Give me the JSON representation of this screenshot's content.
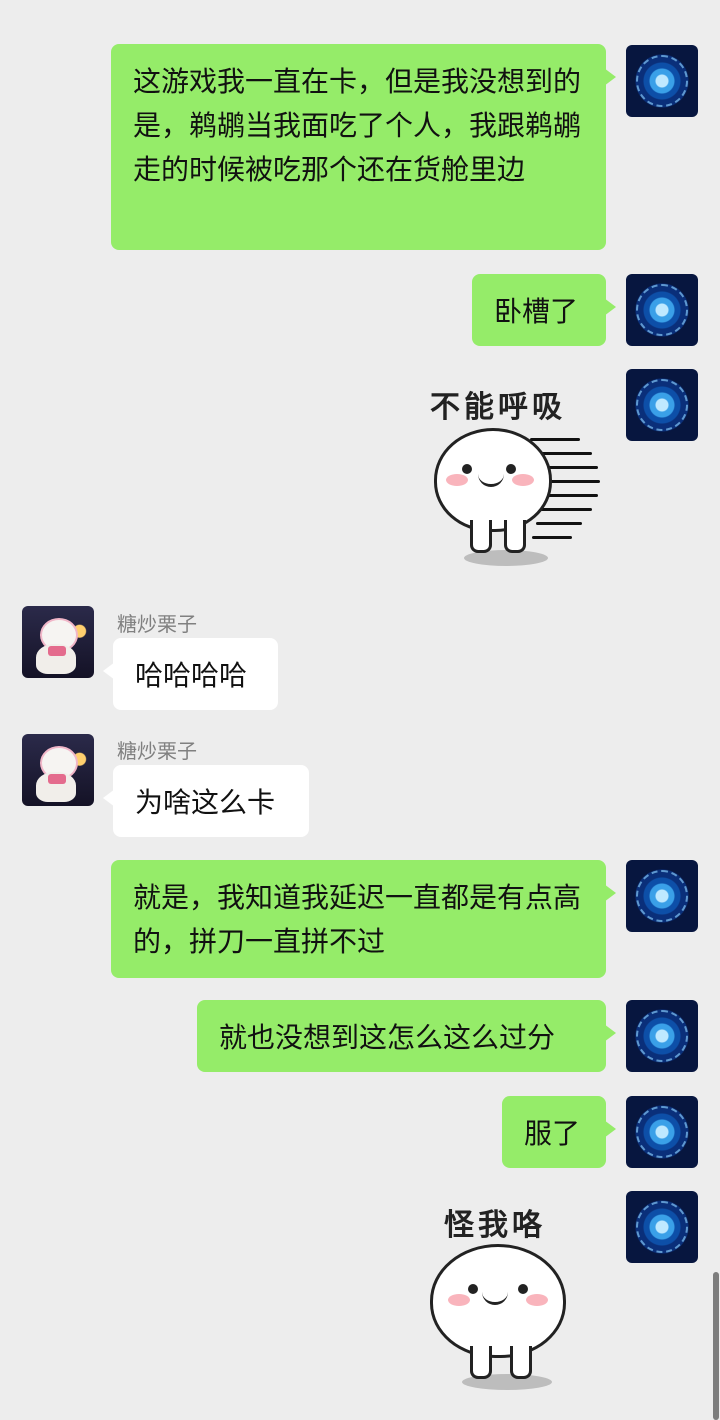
{
  "contacts": {
    "me": {
      "avatar": "galaxy-avatar"
    },
    "other": {
      "name": "糖炒栗子",
      "avatar": "duck-avatar"
    }
  },
  "messages": [
    {
      "from": "me",
      "text": "这游戏我一直在卡，但是我没想到的是，鹈鹕当我面吃了个人，我跟鹈鹕走的时候被吃那个还在货舱里边"
    },
    {
      "from": "me",
      "text": "卧槽了"
    },
    {
      "from": "me",
      "sticker": "cant-breathe",
      "caption": "不能呼吸"
    },
    {
      "from": "other",
      "sender": "糖炒栗子",
      "text": "哈哈哈哈"
    },
    {
      "from": "other",
      "sender": "糖炒栗子",
      "text": "为啥这么卡"
    },
    {
      "from": "me",
      "text": "就是，我知道我延迟一直都是有点高的，拼刀一直拼不过"
    },
    {
      "from": "me",
      "text": "就也没想到这怎么这么过分"
    },
    {
      "from": "me",
      "text": "服了"
    },
    {
      "from": "me",
      "sticker": "blame-me",
      "caption": "怪我咯"
    }
  ],
  "colors": {
    "background": "#ededed",
    "my_bubble": "#95ec69",
    "their_bubble": "#ffffff"
  }
}
